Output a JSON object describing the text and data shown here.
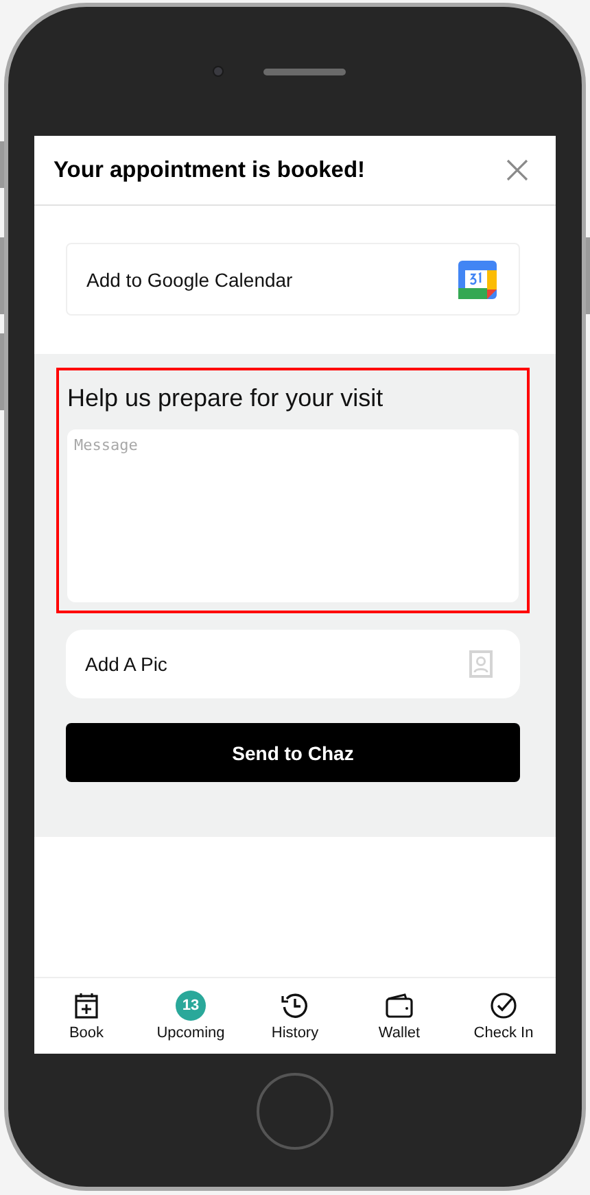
{
  "header": {
    "title": "Your appointment is booked!"
  },
  "calendar_card": {
    "label": "Add to Google Calendar"
  },
  "prepare": {
    "heading": "Help us prepare for your visit",
    "highlighted": true,
    "message": {
      "placeholder": "Message"
    }
  },
  "pic_card": {
    "label": "Add A Pic"
  },
  "send_button": {
    "label": "Send to Chaz"
  },
  "nav": [
    {
      "kind": "book",
      "label": "Book"
    },
    {
      "kind": "badge",
      "label": "Upcoming",
      "badge": "13"
    },
    {
      "kind": "history",
      "label": "History"
    },
    {
      "kind": "wallet",
      "label": "Wallet"
    },
    {
      "kind": "checkin",
      "label": "Check In"
    }
  ]
}
